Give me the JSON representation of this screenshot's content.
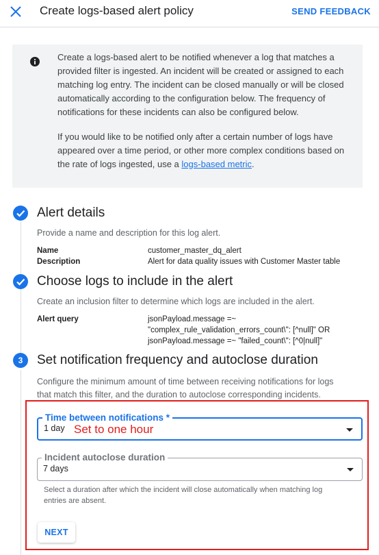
{
  "header": {
    "title": "Create logs-based alert policy",
    "feedback_label": "SEND FEEDBACK"
  },
  "info": {
    "paragraph1": "Create a logs-based alert to be notified whenever a log that matches a provided filter is ingested. An incident will be created or assigned to each matching log entry. The incident can be closed manually or will be closed automatically according to the configuration below. The frequency of notifications for these incidents can also be configured below.",
    "paragraph2_prefix": "If you would like to be notified only after a certain number of logs have appeared over a time period, or other more complex conditions based on the rate of logs ingested, use a ",
    "paragraph2_link": "logs-based metric",
    "paragraph2_suffix": "."
  },
  "steps": [
    {
      "title": "Alert details",
      "description": "Provide a name and description for this log alert.",
      "fields": [
        {
          "key": "Name",
          "value": "customer_master_dq_alert"
        },
        {
          "key": "Description",
          "value": "Alert for data quality issues with Customer Master table"
        }
      ]
    },
    {
      "title": "Choose logs to include in the alert",
      "description": "Create an inclusion filter to determine which logs are included in the alert.",
      "fields": [
        {
          "key": "Alert query",
          "lines": [
            "jsonPayload.message =~",
            "\"complex_rule_validation_errors_count\\\": [^null]\" OR",
            "jsonPayload.message =~ \"failed_count\\\": [^0|null]\""
          ]
        }
      ]
    },
    {
      "number": "3",
      "title": "Set notification frequency and autoclose duration",
      "description_line1": "Configure the minimum amount of time between receiving notifications for logs",
      "description_line2": "that match this filter, and the duration to autoclose corresponding incidents.",
      "notification_field": {
        "label": "Time between notifications *",
        "value": "1 day"
      },
      "autoclose_field": {
        "label": "Incident autoclose duration",
        "value": "7 days"
      },
      "hint": "Select a duration after which the incident will close automatically when matching log entries are absent.",
      "next_label": "NEXT"
    }
  ],
  "annotation": "Set to one hour",
  "colors": {
    "accent": "#1a73e8",
    "annotation": "#e01d1d",
    "info_background": "#f1f3f4"
  }
}
